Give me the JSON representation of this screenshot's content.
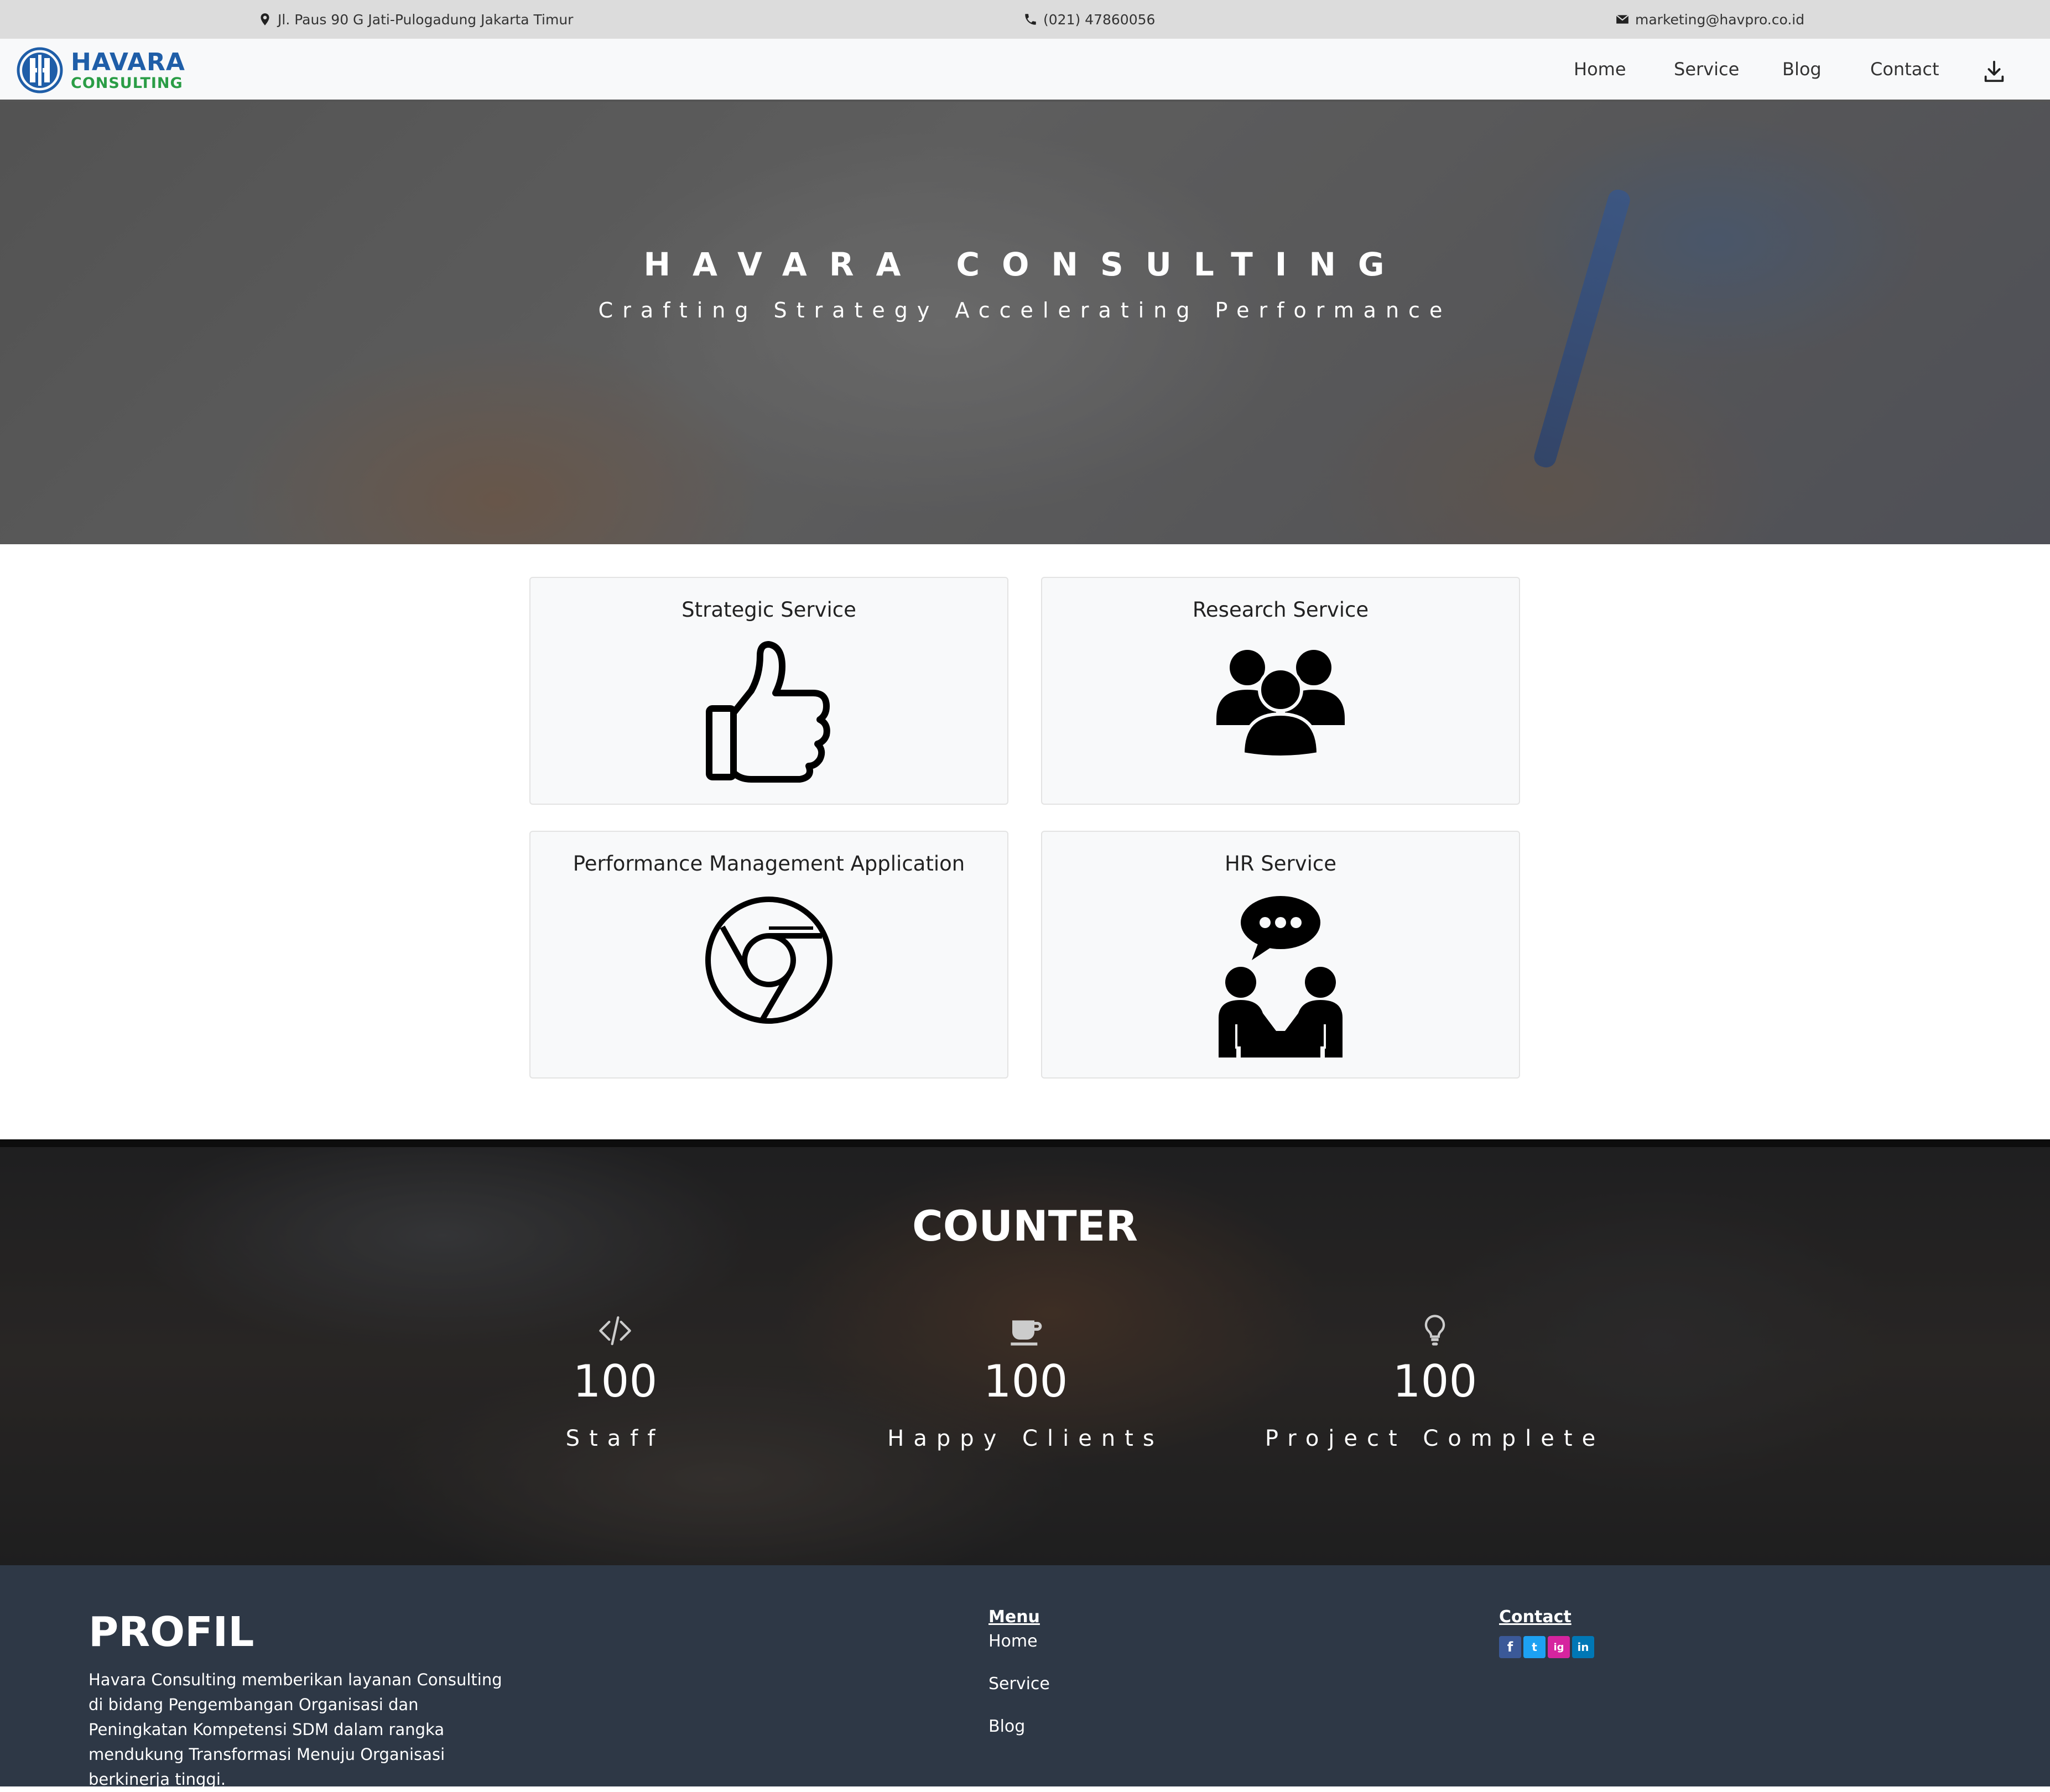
{
  "topbar": {
    "address": "Jl. Paus 90 G Jati-Pulogadung Jakarta Timur",
    "phone": "(021) 47860056",
    "email": "marketing@havpro.co.id"
  },
  "brand": {
    "name": "HAVARA",
    "tagline": "CONSULTING",
    "primary": "#1f5ea8",
    "accent": "#2a9d46"
  },
  "nav": {
    "links": [
      "Home",
      "Service",
      "Blog",
      "Contact"
    ],
    "download_icon": "download-icon"
  },
  "hero": {
    "title": "HAVARA CONSULTING",
    "subtitle": "Crafting Strategy Accelerating Performance"
  },
  "services": [
    {
      "title": "Strategic Service",
      "icon": "thumbs-up-icon"
    },
    {
      "title": "Research Service",
      "icon": "group-icon"
    },
    {
      "title": "Performance Management Application",
      "icon": "chrome-icon"
    },
    {
      "title": "HR Service",
      "icon": "conversation-icon"
    }
  ],
  "counter": {
    "title": "COUNTER",
    "stats": [
      {
        "icon": "code-icon",
        "value": "100",
        "label": "Staff"
      },
      {
        "icon": "coffee-icon",
        "value": "100",
        "label": "Happy Clients"
      },
      {
        "icon": "lightbulb-icon",
        "value": "100",
        "label": "Project Complete"
      }
    ]
  },
  "footer": {
    "title": "PROFIL",
    "description": "Havara Consulting memberikan layanan Consulting di bidang Pengembangan Organisasi dan Peningkatan Kompetensi SDM dalam rangka mendukung Transformasi Menuju Organisasi berkinerja tinggi.",
    "menu_heading": "Menu",
    "menu_links": [
      "Home",
      "Service",
      "Blog"
    ],
    "contact_heading": "Contact",
    "socials": [
      {
        "name": "facebook-icon",
        "glyph": "f",
        "color": "#3b5998"
      },
      {
        "name": "twitter-icon",
        "glyph": "t",
        "color": "#1da1f2"
      },
      {
        "name": "instagram-icon",
        "glyph": "ig",
        "color": "#d6249f"
      },
      {
        "name": "linkedin-icon",
        "glyph": "in",
        "color": "#0077b5"
      }
    ]
  }
}
